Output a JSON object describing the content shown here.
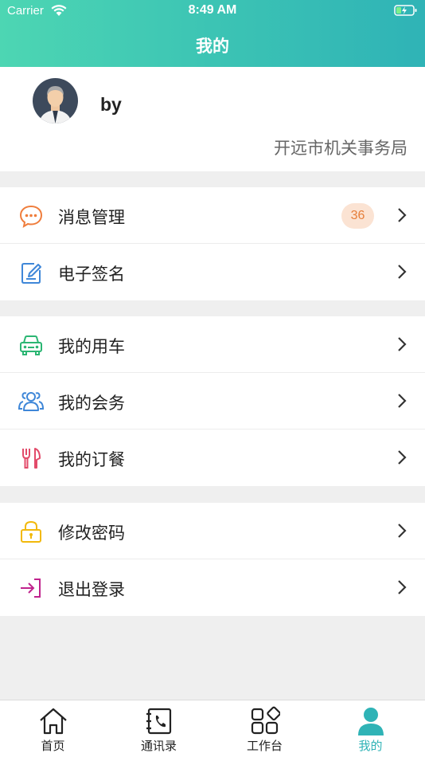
{
  "status_bar": {
    "carrier": "Carrier",
    "time": "8:49 AM"
  },
  "nav": {
    "title": "我的"
  },
  "profile": {
    "name": "by",
    "organization": "开远市机关事务局"
  },
  "menu": {
    "messages": {
      "label": "消息管理",
      "badge": "36",
      "icon": "chat-bubble-icon"
    },
    "signature": {
      "label": "电子签名",
      "icon": "edit-signature-icon"
    },
    "car": {
      "label": "我的用车",
      "icon": "car-icon"
    },
    "meeting": {
      "label": "我的会务",
      "icon": "people-icon"
    },
    "meal": {
      "label": "我的订餐",
      "icon": "fork-knife-icon"
    },
    "password": {
      "label": "修改密码",
      "icon": "lock-icon"
    },
    "logout": {
      "label": "退出登录",
      "icon": "logout-icon"
    }
  },
  "tabbar": {
    "home": {
      "label": "首页",
      "icon": "home-icon"
    },
    "contacts": {
      "label": "通讯录",
      "icon": "contacts-book-icon"
    },
    "workbench": {
      "label": "工作台",
      "icon": "apps-grid-icon"
    },
    "me": {
      "label": "我的",
      "icon": "user-icon",
      "active": true
    }
  },
  "colors": {
    "accent": "#2fb3b6",
    "header_start": "#4dd6b3",
    "badge_bg": "#fbe3d3",
    "badge_text": "#e67e3a"
  }
}
